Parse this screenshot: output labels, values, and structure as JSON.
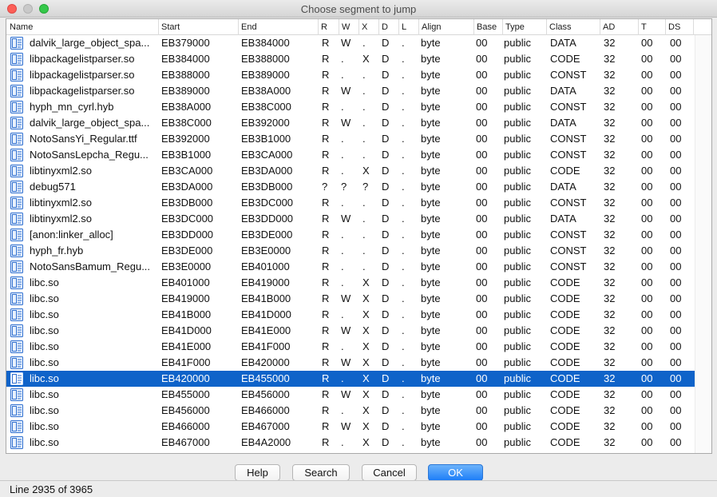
{
  "window": {
    "title": "Choose segment to jump"
  },
  "columns": [
    "Name",
    "Start",
    "End",
    "R",
    "W",
    "X",
    "D",
    "L",
    "Align",
    "Base",
    "Type",
    "Class",
    "AD",
    "T",
    "DS"
  ],
  "rows": [
    [
      "dalvik_large_object_spa...",
      "EB379000",
      "EB384000",
      "R",
      "W",
      ".",
      "D",
      ".",
      "byte",
      "00",
      "public",
      "DATA",
      "32",
      "00",
      "00"
    ],
    [
      "libpackagelistparser.so",
      "EB384000",
      "EB388000",
      "R",
      ".",
      "X",
      "D",
      ".",
      "byte",
      "00",
      "public",
      "CODE",
      "32",
      "00",
      "00"
    ],
    [
      "libpackagelistparser.so",
      "EB388000",
      "EB389000",
      "R",
      ".",
      ".",
      "D",
      ".",
      "byte",
      "00",
      "public",
      "CONST",
      "32",
      "00",
      "00"
    ],
    [
      "libpackagelistparser.so",
      "EB389000",
      "EB38A000",
      "R",
      "W",
      ".",
      "D",
      ".",
      "byte",
      "00",
      "public",
      "DATA",
      "32",
      "00",
      "00"
    ],
    [
      "hyph_mn_cyrl.hyb",
      "EB38A000",
      "EB38C000",
      "R",
      ".",
      ".",
      "D",
      ".",
      "byte",
      "00",
      "public",
      "CONST",
      "32",
      "00",
      "00"
    ],
    [
      "dalvik_large_object_spa...",
      "EB38C000",
      "EB392000",
      "R",
      "W",
      ".",
      "D",
      ".",
      "byte",
      "00",
      "public",
      "DATA",
      "32",
      "00",
      "00"
    ],
    [
      "NotoSansYi_Regular.ttf",
      "EB392000",
      "EB3B1000",
      "R",
      ".",
      ".",
      "D",
      ".",
      "byte",
      "00",
      "public",
      "CONST",
      "32",
      "00",
      "00"
    ],
    [
      "NotoSansLepcha_Regu...",
      "EB3B1000",
      "EB3CA000",
      "R",
      ".",
      ".",
      "D",
      ".",
      "byte",
      "00",
      "public",
      "CONST",
      "32",
      "00",
      "00"
    ],
    [
      "libtinyxml2.so",
      "EB3CA000",
      "EB3DA000",
      "R",
      ".",
      "X",
      "D",
      ".",
      "byte",
      "00",
      "public",
      "CODE",
      "32",
      "00",
      "00"
    ],
    [
      "debug571",
      "EB3DA000",
      "EB3DB000",
      "?",
      "?",
      "?",
      "D",
      ".",
      "byte",
      "00",
      "public",
      "DATA",
      "32",
      "00",
      "00"
    ],
    [
      "libtinyxml2.so",
      "EB3DB000",
      "EB3DC000",
      "R",
      ".",
      ".",
      "D",
      ".",
      "byte",
      "00",
      "public",
      "CONST",
      "32",
      "00",
      "00"
    ],
    [
      "libtinyxml2.so",
      "EB3DC000",
      "EB3DD000",
      "R",
      "W",
      ".",
      "D",
      ".",
      "byte",
      "00",
      "public",
      "DATA",
      "32",
      "00",
      "00"
    ],
    [
      "[anon:linker_alloc]",
      "EB3DD000",
      "EB3DE000",
      "R",
      ".",
      ".",
      "D",
      ".",
      "byte",
      "00",
      "public",
      "CONST",
      "32",
      "00",
      "00"
    ],
    [
      "hyph_fr.hyb",
      "EB3DE000",
      "EB3E0000",
      "R",
      ".",
      ".",
      "D",
      ".",
      "byte",
      "00",
      "public",
      "CONST",
      "32",
      "00",
      "00"
    ],
    [
      "NotoSansBamum_Regu...",
      "EB3E0000",
      "EB401000",
      "R",
      ".",
      ".",
      "D",
      ".",
      "byte",
      "00",
      "public",
      "CONST",
      "32",
      "00",
      "00"
    ],
    [
      "libc.so",
      "EB401000",
      "EB419000",
      "R",
      ".",
      "X",
      "D",
      ".",
      "byte",
      "00",
      "public",
      "CODE",
      "32",
      "00",
      "00"
    ],
    [
      "libc.so",
      "EB419000",
      "EB41B000",
      "R",
      "W",
      "X",
      "D",
      ".",
      "byte",
      "00",
      "public",
      "CODE",
      "32",
      "00",
      "00"
    ],
    [
      "libc.so",
      "EB41B000",
      "EB41D000",
      "R",
      ".",
      "X",
      "D",
      ".",
      "byte",
      "00",
      "public",
      "CODE",
      "32",
      "00",
      "00"
    ],
    [
      "libc.so",
      "EB41D000",
      "EB41E000",
      "R",
      "W",
      "X",
      "D",
      ".",
      "byte",
      "00",
      "public",
      "CODE",
      "32",
      "00",
      "00"
    ],
    [
      "libc.so",
      "EB41E000",
      "EB41F000",
      "R",
      ".",
      "X",
      "D",
      ".",
      "byte",
      "00",
      "public",
      "CODE",
      "32",
      "00",
      "00"
    ],
    [
      "libc.so",
      "EB41F000",
      "EB420000",
      "R",
      "W",
      "X",
      "D",
      ".",
      "byte",
      "00",
      "public",
      "CODE",
      "32",
      "00",
      "00"
    ],
    [
      "libc.so",
      "EB420000",
      "EB455000",
      "R",
      ".",
      "X",
      "D",
      ".",
      "byte",
      "00",
      "public",
      "CODE",
      "32",
      "00",
      "00"
    ],
    [
      "libc.so",
      "EB455000",
      "EB456000",
      "R",
      "W",
      "X",
      "D",
      ".",
      "byte",
      "00",
      "public",
      "CODE",
      "32",
      "00",
      "00"
    ],
    [
      "libc.so",
      "EB456000",
      "EB466000",
      "R",
      ".",
      "X",
      "D",
      ".",
      "byte",
      "00",
      "public",
      "CODE",
      "32",
      "00",
      "00"
    ],
    [
      "libc.so",
      "EB466000",
      "EB467000",
      "R",
      "W",
      "X",
      "D",
      ".",
      "byte",
      "00",
      "public",
      "CODE",
      "32",
      "00",
      "00"
    ],
    [
      "libc.so",
      "EB467000",
      "EB4A2000",
      "R",
      ".",
      "X",
      "D",
      ".",
      "byte",
      "00",
      "public",
      "CODE",
      "32",
      "00",
      "00"
    ]
  ],
  "selected_row": 21,
  "buttons": {
    "help": "Help",
    "search": "Search",
    "cancel": "Cancel",
    "ok": "OK"
  },
  "status": {
    "line_text": "Line 2935 of 3965"
  },
  "icon": "segment-icon",
  "colors": {
    "selection": "#0f63c9",
    "ok_button": "#1e7ef8"
  }
}
